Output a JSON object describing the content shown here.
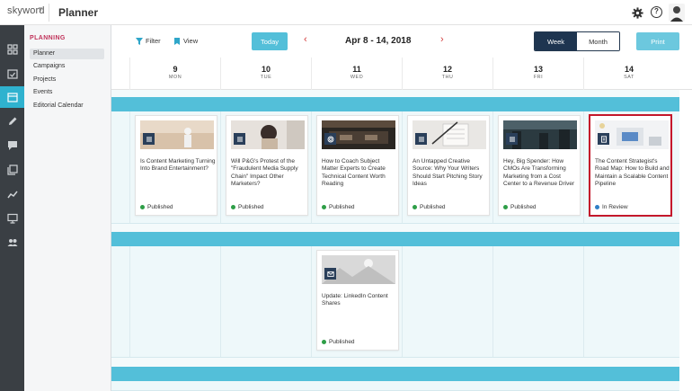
{
  "header": {
    "brand": "skyword",
    "app_title": "Planner",
    "icons": [
      "gear-icon",
      "help-icon",
      "avatar"
    ]
  },
  "rail": {
    "items": [
      "grid-icon",
      "calendar-check-icon",
      "calendar-icon",
      "pen-icon",
      "chat-icon",
      "gallery-icon",
      "chart-icon",
      "monitor-icon",
      "users-icon"
    ],
    "active_index": 2
  },
  "subnav": {
    "heading": "PLANNING",
    "items": [
      "Planner",
      "Campaigns",
      "Projects",
      "Events",
      "Editorial Calendar"
    ]
  },
  "toolbar": {
    "filter_label": "Filter",
    "view_label": "View",
    "today_label": "Today",
    "date_range": "Apr 8 - 14, 2018",
    "prev_arrow": "‹",
    "next_arrow": "›",
    "week_label": "Week",
    "month_label": "Month",
    "print_label": "Print"
  },
  "days": [
    {
      "num": "9",
      "name": "MON"
    },
    {
      "num": "10",
      "name": "TUE"
    },
    {
      "num": "11",
      "name": "WED"
    },
    {
      "num": "12",
      "name": "THU"
    },
    {
      "num": "13",
      "name": "FRI"
    },
    {
      "num": "14",
      "name": "SAT"
    }
  ],
  "cards": [
    {
      "title": "Is Content Marketing Turning Into Brand Entertainment?",
      "status": "Published"
    },
    {
      "title": "Will P&G's Protest of the \"Fraudulent Media Supply Chain\" Impact Other Marketers?",
      "status": "Published"
    },
    {
      "title": "How to Coach Subject Matter Experts to Create Technical Content Worth Reading",
      "status": "Published"
    },
    {
      "title": "An Untapped Creative Source: Why Your Writers Should Start Pitching Story Ideas",
      "status": "Published"
    },
    {
      "title": "Hey, Big Spender: How CMOs Are Transforming Marketing from a Cost Center to a Revenue Driver",
      "status": "Published"
    },
    {
      "title": "The Content Strategist's Road Map: How to Build and Maintain a Scalable Content Pipeline",
      "status": "In Review"
    },
    {
      "title": "Update: LinkedIn Content Shares",
      "status": "Published"
    }
  ],
  "colors": {
    "accent": "#53bfd9",
    "published": "#2e9e47",
    "in_review": "#2f7fc6",
    "selected_border": "#c4182b",
    "navy": "#1e3550"
  }
}
